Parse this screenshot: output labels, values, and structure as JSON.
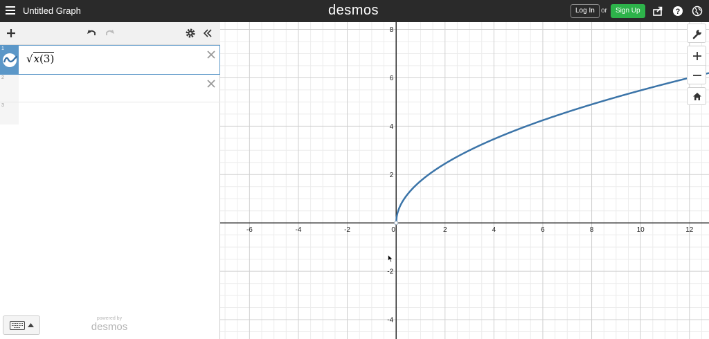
{
  "topbar": {
    "title": "Untitled Graph",
    "logo": "desmos",
    "login_label": "Log In",
    "or_label": "or",
    "signup_label": "Sign Up",
    "icons": [
      "menu-icon",
      "share-icon",
      "help-icon",
      "globe-icon"
    ]
  },
  "panel": {
    "header_icons": [
      "add-icon",
      "undo-icon",
      "redo-icon",
      "settings-icon",
      "collapse-icon"
    ],
    "expressions": [
      {
        "number": "1",
        "latex_display": {
          "radical": "√",
          "var": "x",
          "open": "(",
          "digit": "3",
          "close": ")"
        }
      },
      {
        "number": "2"
      },
      {
        "number": "3"
      }
    ],
    "powered_by": "powered by",
    "powered_logo": "desmos"
  },
  "graph_controls": [
    "wrench-icon",
    "zoom-in-icon",
    "zoom-out-icon",
    "home-icon"
  ],
  "colors": {
    "curve": "#3b74a8",
    "accent": "#5b97c8",
    "signup": "#2db34a"
  },
  "chart_data": {
    "type": "line",
    "function": "sqrt(3x)",
    "xlim": [
      -7.2,
      12.8
    ],
    "ylim": [
      -4.8,
      8.3
    ],
    "x_ticks": [
      -6,
      -4,
      -2,
      0,
      2,
      4,
      6,
      8,
      10,
      12
    ],
    "y_ticks": [
      -4,
      -2,
      2,
      4,
      6,
      8
    ],
    "grid": true,
    "series": [
      {
        "points": [
          [
            0,
            0
          ],
          [
            0.25,
            0.87
          ],
          [
            0.5,
            1.22
          ],
          [
            1,
            1.73
          ],
          [
            2,
            2.45
          ],
          [
            3,
            3
          ],
          [
            4,
            3.46
          ],
          [
            5,
            3.87
          ],
          [
            6,
            4.24
          ],
          [
            7,
            4.58
          ],
          [
            8,
            4.9
          ],
          [
            9,
            5.2
          ],
          [
            10,
            5.48
          ],
          [
            11,
            5.74
          ],
          [
            12,
            6
          ],
          [
            12.8,
            6.2
          ]
        ]
      }
    ]
  }
}
